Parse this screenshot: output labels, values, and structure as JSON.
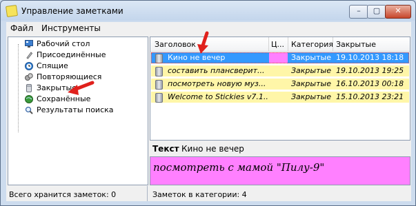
{
  "window": {
    "title": "Управление заметками",
    "buttons": {
      "minimize": "–",
      "maximize": "▢",
      "close": "✕"
    }
  },
  "menu": [
    "Файл",
    "Инструменты"
  ],
  "tree": [
    {
      "label": "Рабочий стол",
      "icon": "desktop-icon"
    },
    {
      "label": "Присоединённые",
      "icon": "paperclip-icon"
    },
    {
      "label": "Спящие",
      "icon": "clock-icon"
    },
    {
      "label": "Повторяющиеся",
      "icon": "recurring-icon"
    },
    {
      "label": "Закрытые",
      "icon": "archive-jar-icon"
    },
    {
      "label": "Сохранённые",
      "icon": "globe-icon"
    },
    {
      "label": "Результаты поиска",
      "icon": "magnifier-icon"
    }
  ],
  "table": {
    "columns": [
      "Заголовок",
      "Ц...",
      "Категория",
      "Закрытые"
    ],
    "rows": [
      {
        "title": "Кино не вечер",
        "color": "#ff80ff",
        "category": "Закрытые",
        "closed": "19.10.2013 18:18",
        "selected": true
      },
      {
        "title": "составить плансверит...",
        "color": "#fff6a8",
        "category": "Закрытые",
        "closed": "19.10.2013 19:25",
        "selected": false
      },
      {
        "title": "посмотреть новую муз...",
        "color": "#fff6a8",
        "category": "Закрытые",
        "closed": "16.10.2013 00:18",
        "selected": false
      },
      {
        "title": "Welcome to Stickies v7.1...",
        "color": "#fff6a8",
        "category": "Закрытые",
        "closed": "15.10.2013 23:21",
        "selected": false
      }
    ]
  },
  "detail": {
    "label": "Текст",
    "title": "Кино не вечер",
    "note": "посмотреть с мамой \"Пилу-9\""
  },
  "status": {
    "left": "Всего хранится заметок: 0",
    "right": "Заметок в категории: 4"
  },
  "colors": {
    "selection": "#3399ff",
    "note_pink": "#ff80ff",
    "note_yellow": "#fff6a8",
    "annotation_arrow": "#e0211c"
  }
}
